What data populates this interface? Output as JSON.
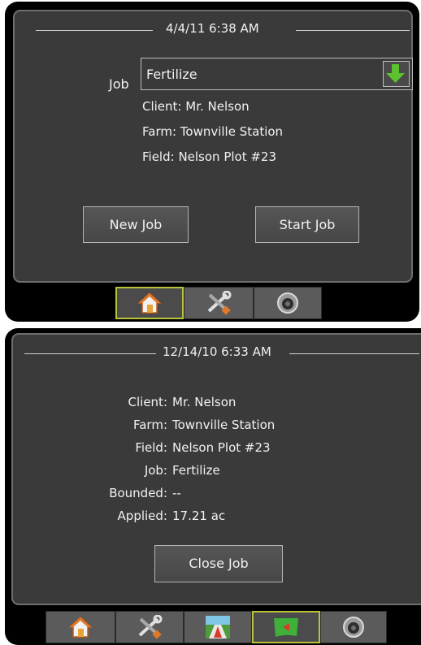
{
  "panel1": {
    "datetime": "4/4/11 6:38 AM",
    "job_label": "Job",
    "job_value": "Fertilize",
    "client": "Client: Mr. Nelson",
    "farm": "Farm: Townville Station",
    "field": "Field: Nelson Plot #23",
    "new_job_label": "New Job",
    "start_job_label": "Start Job",
    "tabs": [
      "home-icon",
      "tools-icon",
      "camera-icon"
    ],
    "active_tab": "home-icon"
  },
  "panel2": {
    "datetime": "12/14/10 6:33 AM",
    "rows": [
      {
        "key": "Client:",
        "value": "Mr. Nelson"
      },
      {
        "key": "Farm:",
        "value": "Townville Station"
      },
      {
        "key": "Field:",
        "value": "Nelson Plot #23"
      },
      {
        "key": "Job:",
        "value": "Fertilize"
      },
      {
        "key": "Bounded:",
        "value": "--"
      },
      {
        "key": "Applied:",
        "value": "17.21 ac"
      }
    ],
    "close_job_label": "Close Job",
    "tabs": [
      "home-icon",
      "tools-icon",
      "guidance-icon",
      "map-icon",
      "camera-icon"
    ],
    "active_tab": "map-icon"
  },
  "colors": {
    "accent_border": "#b8c23a",
    "arrow_green": "#5cc22e"
  }
}
